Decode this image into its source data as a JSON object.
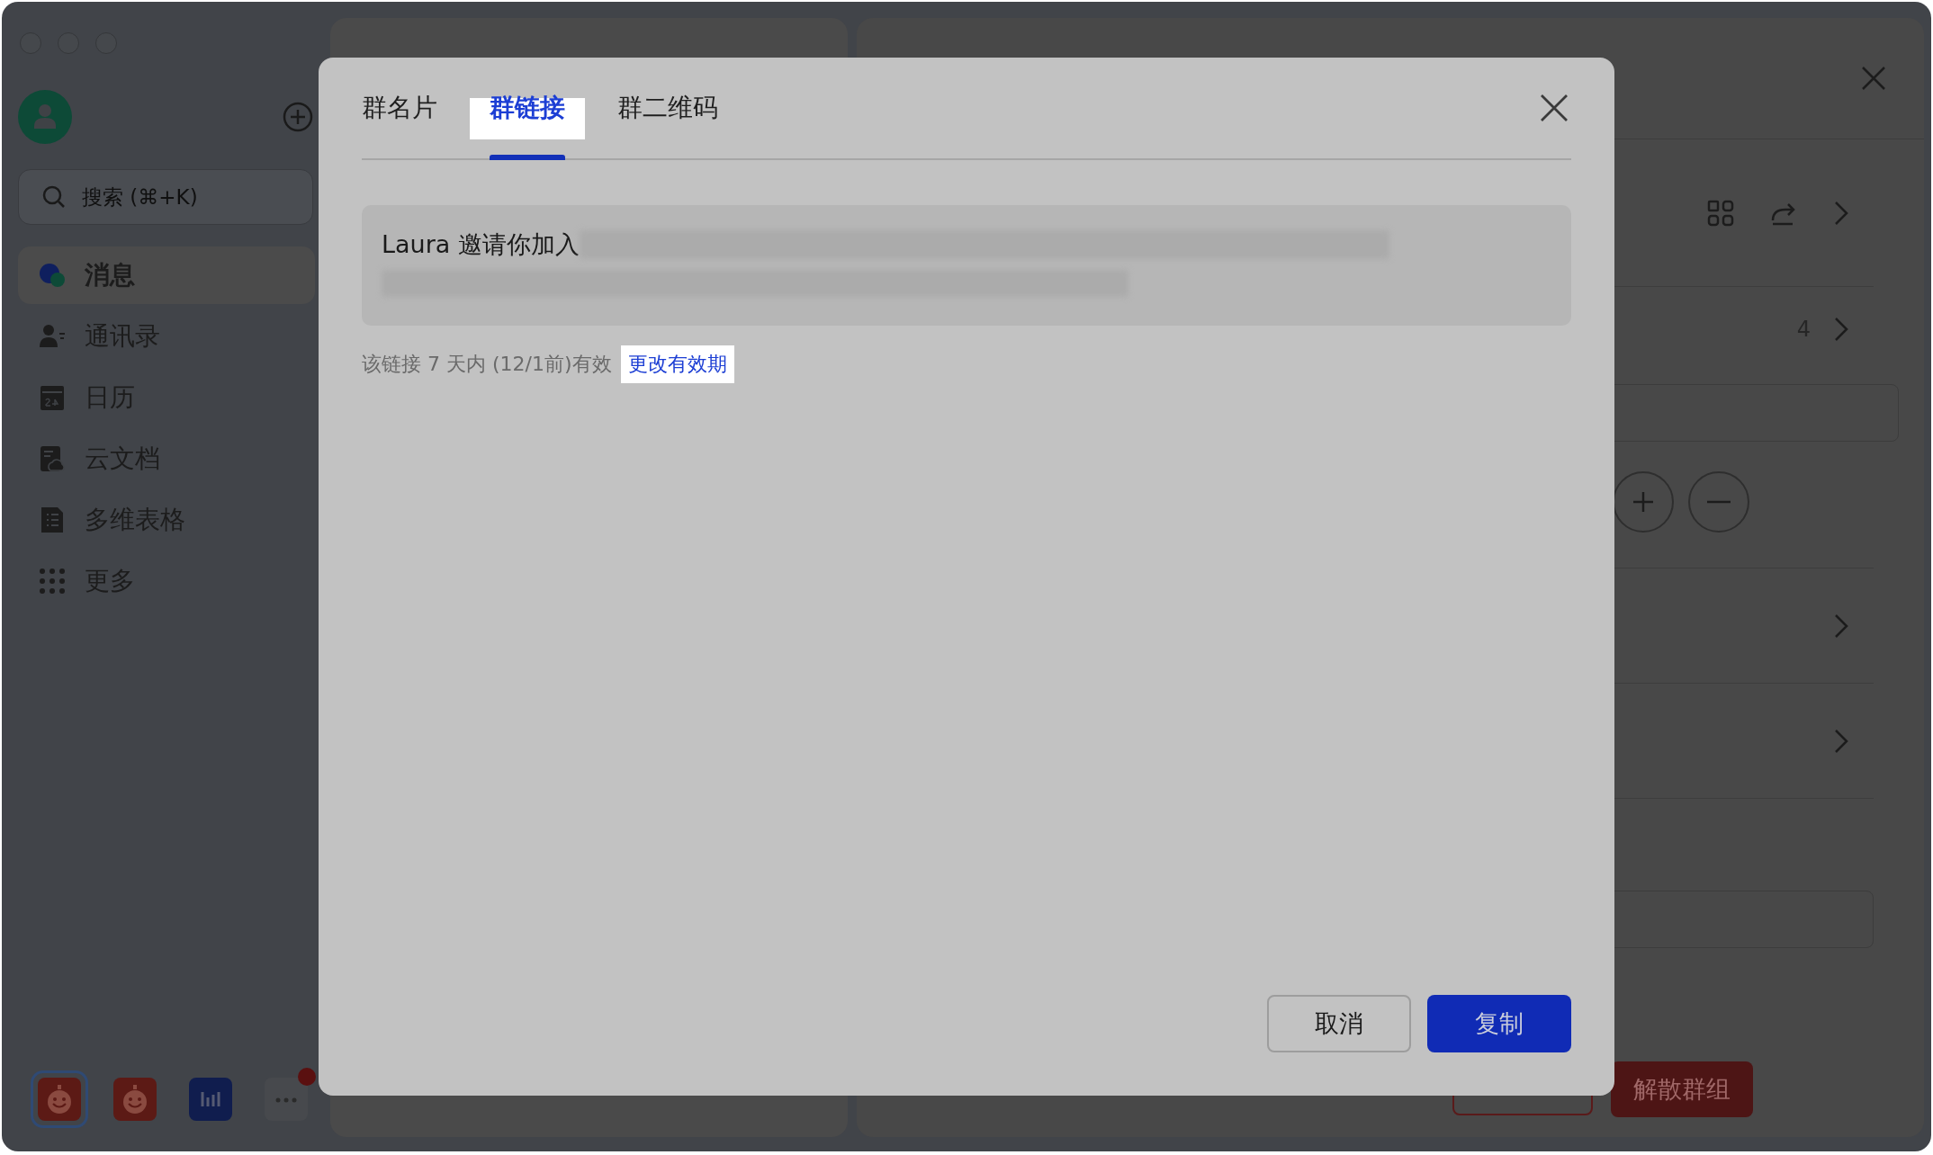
{
  "sidebar": {
    "search": {
      "placeholder": "搜索 (⌘+K)"
    },
    "items": [
      {
        "label": "消息",
        "selected": true
      },
      {
        "label": "通讯录",
        "selected": false
      },
      {
        "label": "日历",
        "selected": false
      },
      {
        "label": "云文档",
        "selected": false
      },
      {
        "label": "多维表格",
        "selected": false
      },
      {
        "label": "更多",
        "selected": false
      }
    ],
    "dock": [
      {
        "selected": true,
        "notification": false
      },
      {
        "selected": false,
        "notification": false
      },
      {
        "selected": false,
        "notification": false
      },
      {
        "selected": false,
        "notification": true
      }
    ]
  },
  "group_settings": {
    "member_count": "4",
    "dissolve_button": "解散群组"
  },
  "dialog": {
    "tabs": [
      {
        "label": "群名片",
        "selected": false
      },
      {
        "label": "群链接",
        "selected": true
      },
      {
        "label": "群二维码",
        "selected": false
      }
    ],
    "invite_text": "Laura 邀请你加入",
    "expiry_note": "该链接 7 天内 (12/1前)有效",
    "change_link": "更改有效期",
    "buttons": [
      {
        "label": "取消",
        "kind": "secondary"
      },
      {
        "label": "复制",
        "kind": "primary"
      }
    ]
  }
}
